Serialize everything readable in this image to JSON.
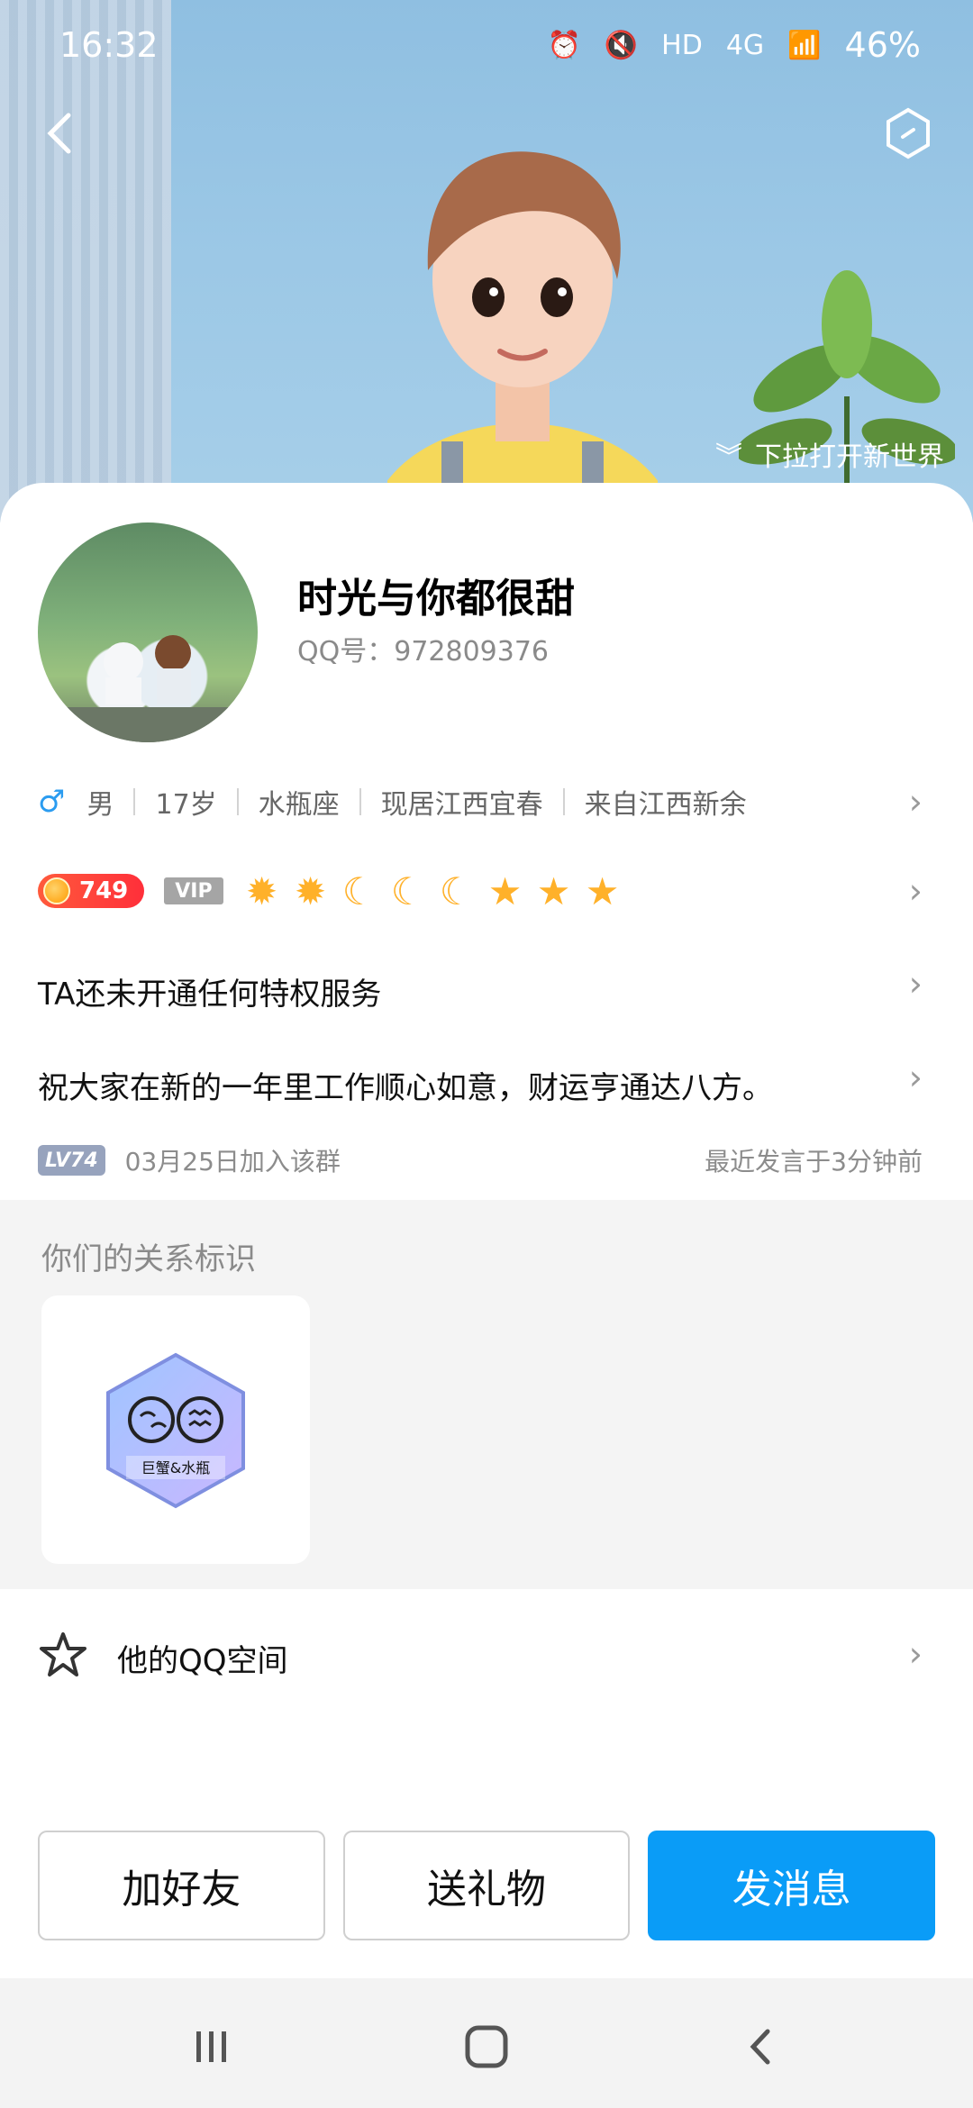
{
  "status_bar": {
    "time": "16:32",
    "hd": "HD",
    "net": "4G",
    "battery": "46%"
  },
  "header": {
    "pull_hint": "下拉打开新世界"
  },
  "profile": {
    "nickname": "时光与你都很甜",
    "qq_number": "QQ号：972809376"
  },
  "info": {
    "gender": "男",
    "age": "17岁",
    "zodiac": "水瓶座",
    "location": "现居江西宜春",
    "hometown": "来自江西新余"
  },
  "badges": {
    "level": "749",
    "vip": "VIP",
    "level_icons": [
      "sun",
      "sun",
      "moon",
      "moon",
      "moon",
      "star",
      "star",
      "star"
    ]
  },
  "privilege_text": "TA还未开通任何特权服务",
  "signature": "祝大家在新的一年里工作顺心如意，财运亨通达八方。",
  "group": {
    "lv": "LV74",
    "joined": "03月25日加入该群",
    "recent": "最近发言于3分钟前"
  },
  "relationship": {
    "title": "你们的关系标识",
    "badge_text": "巨蟹&水瓶"
  },
  "qzone": {
    "label": "他的QQ空间"
  },
  "actions": {
    "add_friend": "加好友",
    "send_gift": "送礼物",
    "send_message": "发消息"
  },
  "colors": {
    "primary": "#0a9cf7",
    "level_red": "#ff3a3a",
    "icon_gold": "#ffb12a"
  }
}
